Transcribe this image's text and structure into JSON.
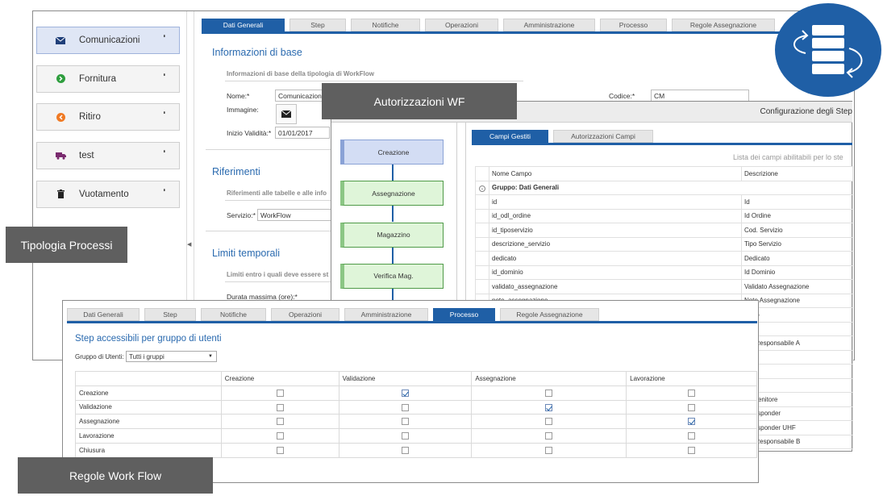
{
  "tipologia": {
    "label": "Tipologia Processi",
    "sidebar": [
      {
        "label": "Comunicazioni",
        "icon": "envelope-icon",
        "color": "#1f3f7a",
        "active": true
      },
      {
        "label": "Fornitura",
        "icon": "arrow-right-circle-icon",
        "color": "#2e9e3e",
        "active": false
      },
      {
        "label": "Ritiro",
        "icon": "arrow-left-circle-icon",
        "color": "#f07a24",
        "active": false
      },
      {
        "label": "test",
        "icon": "truck-icon",
        "color": "#7a2a6e",
        "active": false
      },
      {
        "label": "Vuotamento",
        "icon": "trash-icon",
        "color": "#222222",
        "active": false
      }
    ],
    "tabs": [
      "Dati Generali",
      "Step",
      "Notifiche",
      "Operazioni",
      "Amministrazione",
      "Processo",
      "Regole Assegnazione"
    ],
    "active_tab": "Dati Generali",
    "info_title": "Informazioni di base",
    "info_sub": "Informazioni di base della tipologia di WorkFlow",
    "nome_label": "Nome:*",
    "nome_value": "Comunicazioni",
    "codice_label": "Codice:*",
    "codice_value": "CM",
    "immagine_label": "Immagine:",
    "inizio_label": "Inizio Validità:*",
    "inizio_value": "01/01/2017",
    "rif_title": "Riferimenti",
    "rif_sub": "Riferimenti alle tabelle e alle info",
    "servizio_label": "Servizio:*",
    "servizio_value": "WorkFlow",
    "limiti_title": "Limiti temporali",
    "limiti_sub": "Limiti entro i quali deve essere st",
    "durata_label": "Durata massima (ore):*"
  },
  "autorizzazioni": {
    "label": "Autorizzazioni  WF",
    "header": "Configurazione degli Step",
    "steps": [
      "Creazione",
      "Assegnazione",
      "Magazzino",
      "Verifica Mag."
    ],
    "tabs": [
      "Campi Gestiti",
      "Autorizzazioni Campi"
    ],
    "grid_title": "Lista dei campi abilitabili per lo ste",
    "columns": [
      "Nome Campo",
      "Descrizione"
    ],
    "group_label": "Gruppo: Dati Generali",
    "rows": [
      [
        "id",
        "Id"
      ],
      [
        "id_odl_ordine",
        "Id Ordine"
      ],
      [
        "id_tiposervizio",
        "Cod. Servizio"
      ],
      [
        "descrizione_servizio",
        "Tipo Servizio"
      ],
      [
        "dedicato",
        "Dedicato"
      ],
      [
        "id_dominio",
        "Id Dominio"
      ],
      [
        "validato_assegnazione",
        "Validato Assegnazione"
      ],
      [
        "note_assegnazione",
        "Note Assegnazione"
      ],
      [
        "",
        "rvizio"
      ],
      [
        "",
        ""
      ],
      [
        "",
        "ato Responsabile A"
      ],
      [
        "",
        "DT"
      ],
      [
        "",
        "DDT"
      ],
      [
        "",
        ""
      ],
      [
        "",
        "Contenitore"
      ],
      [
        "",
        "Transponder"
      ],
      [
        "",
        "Transponder UHF"
      ],
      [
        "",
        "ato Responsabile B"
      ]
    ]
  },
  "regole": {
    "label": "Regole Work Flow",
    "tabs": [
      "Dati Generali",
      "Step",
      "Notifiche",
      "Operazioni",
      "Amministrazione",
      "Processo",
      "Regole Assegnazione"
    ],
    "active_tab": "Processo",
    "title": "Step accessibili per gruppo di utenti",
    "group_label": "Gruppo di Utenti:",
    "group_value": "Tutti i gruppi",
    "columns": [
      "",
      "Creazione",
      "Validazione",
      "Assegnazione",
      "Lavorazione"
    ],
    "rows": [
      {
        "name": "Creazione",
        "checks": [
          false,
          true,
          false,
          false
        ]
      },
      {
        "name": "Validazione",
        "checks": [
          false,
          false,
          true,
          false
        ]
      },
      {
        "name": "Assegnazione",
        "checks": [
          false,
          false,
          false,
          true
        ]
      },
      {
        "name": "Lavorazione",
        "checks": [
          false,
          false,
          false,
          false
        ]
      },
      {
        "name": "Chiusura",
        "checks": [
          false,
          false,
          false,
          false
        ]
      }
    ]
  },
  "colors": {
    "accent": "#1f5fa6",
    "label_bg": "#5f5f5f",
    "step_green": "#dff5d9",
    "step_blue": "#d3ddf4"
  }
}
